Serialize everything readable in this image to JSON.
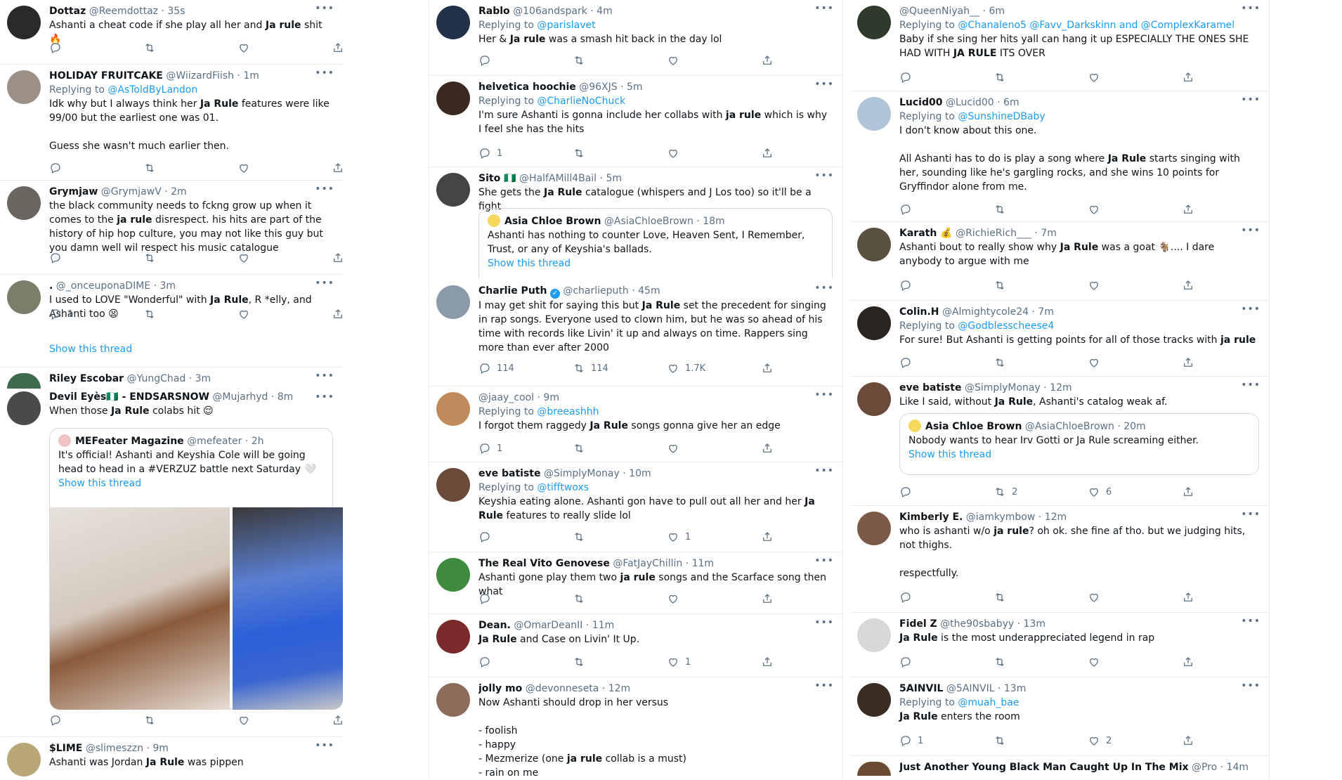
{
  "colors": {
    "link": "#1d9bf0",
    "muted": "#5b7083",
    "border": "#e6ecf0"
  },
  "col1": {
    "t1": {
      "name": "Dottaz",
      "handle": "@Reemdottaz",
      "time": "35s",
      "pre": "Ashanti a cheat code if she play all her and ",
      "bold": "Ja rule",
      "post": " shit 🔥"
    },
    "t2": {
      "name": "HOLIDAY FRUITCAKE",
      "handle": "@WiizardFiish",
      "time": "1m",
      "reply_label": "Replying to",
      "reply_to": "@AsToldByLandon",
      "pre": "Idk why but I always think her ",
      "bold": "Ja Rule",
      "post": " features were like 99/00 but the earliest one was 01.\n\nGuess she wasn't much earlier then."
    },
    "t3": {
      "name": "Grymjaw",
      "handle": "@GrymjawV",
      "time": "2m",
      "pre": "the black community needs to fckng grow up when it comes to the ",
      "bold": "ja rule",
      "post": " disrespect. his hits are part of the history of hip hop culture, you may not like this guy but you damn well wil respect his music catalogue"
    },
    "t4": {
      "name": ".",
      "handle": "@_onceuponaDIME",
      "time": "3m",
      "pre": "I used to LOVE \"Wonderful\" with ",
      "bold": "Ja Rule",
      "post": ", R *elly, and Ashanti too 😫",
      "replies": "1",
      "show_thread": "Show this thread"
    },
    "t5": {
      "name": "Riley Escobar",
      "handle": "@YungChad",
      "time": "3m"
    },
    "t6": {
      "name": "Devil Eyès🇳🇬 - ENDSARSNOW",
      "handle": "@Mujarhyd",
      "time": "8m",
      "pre": "When those ",
      "bold": "Ja Rule",
      "post": " colabs hit 😌",
      "quote": {
        "name": "MEFeater Magazine",
        "handle": "@mefeater",
        "time": "2h",
        "text": "It's official! Ashanti and Keyshia Cole will be going head to head in a #VERZUZ battle next Saturday 🤍",
        "show_thread": "Show this thread"
      }
    },
    "t7": {
      "name": "$LIME",
      "handle": "@slimeszzn",
      "time": "9m",
      "pre": "Ashanti was Jordan ",
      "bold": "Ja Rule",
      "post": " was pippen"
    }
  },
  "col2": {
    "t1": {
      "name": "Rablo",
      "handle": "@106andspark",
      "time": "4m",
      "reply_label": "Replying to",
      "reply_to": "@parislavet",
      "pre": "Her & ",
      "bold": "Ja rule",
      "post": " was a smash hit back in the day lol"
    },
    "t2": {
      "name": "helvetica hoochie",
      "handle": "@96XJS",
      "time": "5m",
      "reply_label": "Replying to",
      "reply_to": "@CharlieNoChuck",
      "pre": "I'm sure Ashanti is gonna include her collabs with ",
      "bold": "ja rule",
      "post": " which is why I feel she has the hits",
      "replies": "1"
    },
    "t3": {
      "name": "Sito 🇳🇬",
      "handle": "@HalfAMill4Bail",
      "time": "5m",
      "pre": "She gets the ",
      "bold": "Ja Rule",
      "post": " catalogue (whispers and J Los too) so it'll be a fight",
      "quote": {
        "name": "Asia Chloe Brown",
        "handle": "@AsiaChloeBrown",
        "time": "18m",
        "text": "Ashanti has nothing to counter Love, Heaven Sent, I Remember, Trust, or any of Keyshia's ballads.",
        "show_thread": "Show this thread"
      }
    },
    "t4": {
      "name": "Charlie Puth",
      "handle": "@charlieputh",
      "time": "45m",
      "pre": "I may get shit for saying this but ",
      "bold": "Ja Rule",
      "post": " set the precedent for singing in rap songs. Everyone used to clown him, but he was so ahead of his time with records like Livin' it up and always on time. Rappers sing more than ever after 2000",
      "replies": "114",
      "retweets": "114",
      "likes": "1.7K"
    },
    "t5": {
      "name": "",
      "handle": "@jaay_cool",
      "time": "9m",
      "reply_label": "Replying to",
      "reply_to": "@breeashhh",
      "pre": "I forgot them raggedy ",
      "bold": "Ja Rule",
      "post": " songs gonna give her an edge",
      "replies": "1"
    },
    "t6": {
      "name": "eve batiste",
      "handle": "@SimplyMonay",
      "time": "10m",
      "reply_label": "Replying to",
      "reply_to": "@tifftwoxs",
      "pre": "Keyshia eating alone. Ashanti gon have to pull out all her and her ",
      "bold": "Ja Rule",
      "post": " features to really slide lol",
      "likes": "1"
    },
    "t7": {
      "name": "The Real Vito Genovese",
      "handle": "@FatJayChillin",
      "time": "11m",
      "pre": "Ashanti gone play them two ",
      "bold": "ja rule",
      "post": " songs and the Scarface song then what"
    },
    "t8": {
      "name": "Dean.",
      "handle": "@OmarDeanII",
      "time": "11m",
      "pre": "",
      "bold": "Ja Rule",
      "post": " and Case on Livin' It Up.",
      "likes": "1"
    },
    "t9": {
      "name": "jolly mo",
      "handle": "@devonneseta",
      "time": "12m",
      "pre": "Now Ashanti should drop in her versus\n\n- foolish\n- happy\n- Mezmerize (one ",
      "bold": "ja rule",
      "post": " collab is a must)\n- rain on me"
    }
  },
  "col3": {
    "t1": {
      "name": "",
      "handle": "@QueenNiyah__",
      "time": "6m",
      "reply_label": "Replying to",
      "reply_to": "@Chanaleno5 @Favv_Darkskinn and @ComplexKaramel",
      "pre": "Baby if she sing her hits yall can hang it up ESPECIALLY THE ONES SHE HAD WITH ",
      "bold": "JA RULE",
      "post": " ITS OVER"
    },
    "t2": {
      "name": "Lucid00",
      "handle": "@Lucid00",
      "time": "6m",
      "reply_label": "Replying to",
      "reply_to": "@SunshineDBaby",
      "pre": "I don't know about this one.\n\nAll Ashanti has to do is play a song where ",
      "bold": "Ja Rule",
      "post": " starts singing with her, sounding like he's gargling rocks, and she wins 10 points for Gryffindor alone from me."
    },
    "t3": {
      "name": "Karath 💰",
      "handle": "@RichieRich___",
      "time": "7m",
      "pre": "Ashanti bout to really show why ",
      "bold": "Ja Rule",
      "post": " was a goat 🐐.... I dare anybody to argue with me"
    },
    "t4": {
      "name": "Colin.H",
      "handle": "@Almightycole24",
      "time": "7m",
      "reply_label": "Replying to",
      "reply_to": "@Godblesscheese4",
      "pre": "For sure! But Ashanti is getting points for all of those tracks with ",
      "bold": "ja rule",
      "post": ""
    },
    "t5": {
      "name": "eve batiste",
      "handle": "@SimplyMonay",
      "time": "12m",
      "pre": "Like I said, without ",
      "bold": "Ja Rule",
      "post": ", Ashanti's catalog weak af.",
      "retweets": "2",
      "likes": "6",
      "quote": {
        "name": "Asia Chloe Brown",
        "handle": "@AsiaChloeBrown",
        "time": "20m",
        "text": "Nobody wants to hear Irv Gotti or Ja Rule screaming either.",
        "show_thread": "Show this thread"
      }
    },
    "t6": {
      "name": "Kimberly E.",
      "handle": "@iamkymbow",
      "time": "12m",
      "pre": "who is ashanti w/o ",
      "bold": "ja rule",
      "post": "? oh ok. she fine af tho. but we judging hits, not thighs.\n\nrespectfully."
    },
    "t7": {
      "name": "Fidel Z",
      "handle": "@the90sbabyy",
      "time": "13m",
      "pre": "",
      "bold": "Ja Rule",
      "post": " is the most underappreciated legend in rap"
    },
    "t8": {
      "name": "5AINVIL",
      "handle": "@5AINVIL",
      "time": "13m",
      "reply_label": "Replying to",
      "reply_to": "@muah_bae",
      "pre": "",
      "bold": "Ja Rule",
      "post": " enters the room",
      "replies": "1",
      "likes": "2"
    },
    "t9": {
      "name": "Just Another Young Black Man Caught Up In The Mix",
      "handle": "@Pro",
      "time": "14m"
    }
  },
  "more_label": "•••",
  "icons": [
    "reply-icon",
    "retweet-icon",
    "like-icon",
    "share-icon",
    "verified-icon"
  ]
}
